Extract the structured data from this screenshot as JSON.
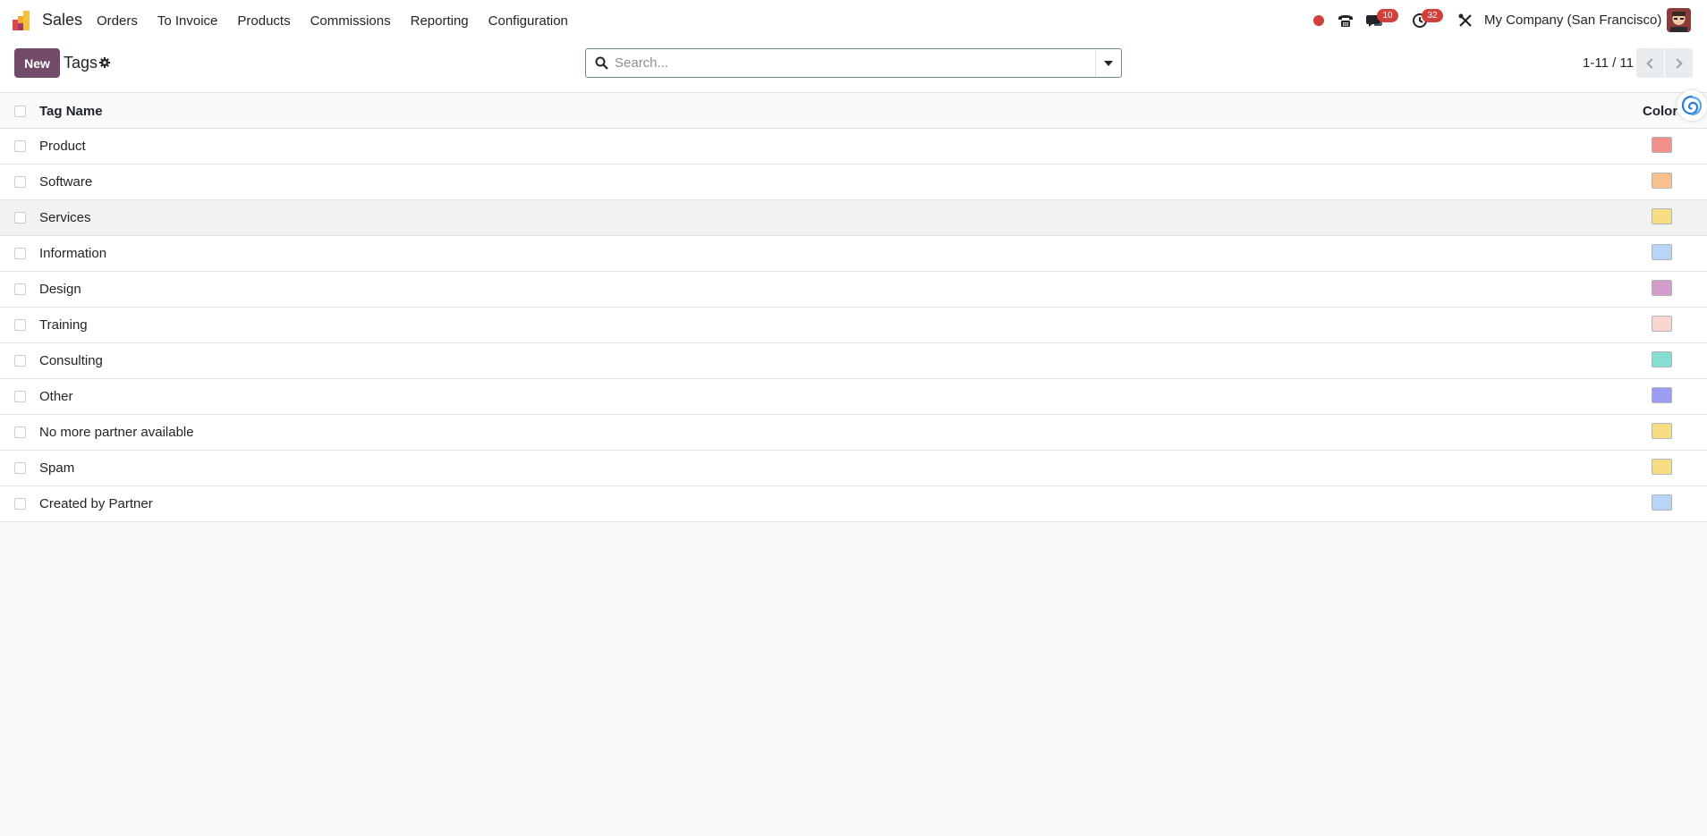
{
  "navbar": {
    "app_name": "Sales",
    "menu": [
      "Orders",
      "To Invoice",
      "Products",
      "Commissions",
      "Reporting",
      "Configuration"
    ],
    "messages_count": "10",
    "activities_count": "32",
    "company": "My Company (San Francisco)",
    "icons": [
      "sales-app-logo",
      "recording-dot-icon",
      "phone-icon",
      "chat-icon",
      "clock-icon",
      "debug-tools-icon",
      "avatar"
    ]
  },
  "control_panel": {
    "new_label": "New",
    "title": "Tags",
    "search_placeholder": "Search...",
    "pager": "1-11 / 11"
  },
  "list": {
    "columns": {
      "name": "Tag Name",
      "color": "Color"
    },
    "rows": [
      {
        "name": "Product",
        "color": "#f4908a"
      },
      {
        "name": "Software",
        "color": "#f7c08e"
      },
      {
        "name": "Services",
        "color": "#f7de84"
      },
      {
        "name": "Information",
        "color": "#b9d5f5"
      },
      {
        "name": "Design",
        "color": "#d39ccb"
      },
      {
        "name": "Training",
        "color": "#f8d6cf"
      },
      {
        "name": "Consulting",
        "color": "#86ddd2"
      },
      {
        "name": "Other",
        "color": "#9b9df2"
      },
      {
        "name": "No more partner available",
        "color": "#f7de84"
      },
      {
        "name": "Spam",
        "color": "#f7de84"
      },
      {
        "name": "Created by Partner",
        "color": "#b9d5f5"
      }
    ],
    "hovered_row": "Services"
  },
  "colors": {
    "brand": "#714b67",
    "badge": "#d23f3a",
    "search_border": "#6c8b8a"
  }
}
